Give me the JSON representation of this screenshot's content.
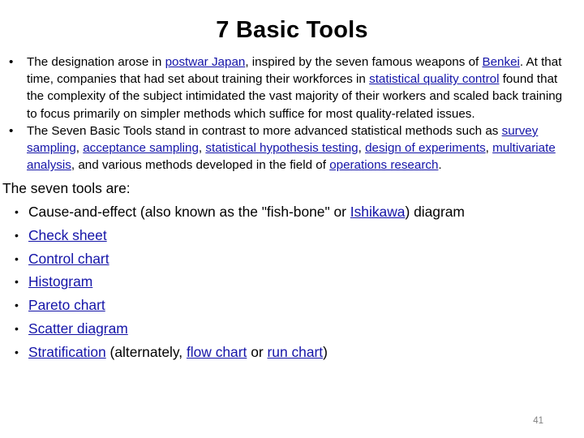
{
  "slide": {
    "title": "7 Basic Tools",
    "page_number": "41",
    "link_color": "#1414A8",
    "text_color": "#000000",
    "page_number_color": "#808080",
    "background_color": "#FFFFFF"
  },
  "bullet_glyph": "•",
  "paragraphs": [
    {
      "bullet": "•",
      "segments": [
        {
          "text": "The designation arose in ",
          "link": false
        },
        {
          "text": "postwar Japan",
          "link": true
        },
        {
          "text": ", inspired by the seven famous weapons of ",
          "link": false
        },
        {
          "text": "Benkei",
          "link": true
        },
        {
          "text": ".  At that time, companies that had set about training their workforces in ",
          "link": false
        },
        {
          "text": "statistical quality control",
          "link": true
        },
        {
          "text": " found that the complexity of the subject intimidated the vast majority of their workers and scaled back training to focus primarily on simpler methods which suffice for most quality-related issues.",
          "link": false
        }
      ]
    },
    {
      "bullet": "•",
      "segments": [
        {
          "text": "The Seven Basic Tools stand in contrast to more advanced statistical methods such as ",
          "link": false
        },
        {
          "text": "survey sampling",
          "link": true
        },
        {
          "text": ", ",
          "link": false
        },
        {
          "text": "acceptance sampling",
          "link": true
        },
        {
          "text": ", ",
          "link": false
        },
        {
          "text": "statistical hypothesis testing",
          "link": true
        },
        {
          "text": ", ",
          "link": false
        },
        {
          "text": "design of experiments",
          "link": true
        },
        {
          "text": ", ",
          "link": false
        },
        {
          "text": "multivariate analysis",
          "link": true
        },
        {
          "text": ", and various methods developed in the field of ",
          "link": false
        },
        {
          "text": "operations research",
          "link": true
        },
        {
          "text": ".",
          "link": false
        }
      ]
    }
  ],
  "lead_in": "The seven tools are:",
  "tools": [
    {
      "bullet": "•",
      "segments": [
        {
          "text": "Cause-and-effect (also known as the \"fish-bone\" or ",
          "link": false
        },
        {
          "text": "Ishikawa",
          "link": true
        },
        {
          "text": ") diagram",
          "link": false
        }
      ]
    },
    {
      "bullet": "•",
      "segments": [
        {
          "text": "Check sheet",
          "link": true
        }
      ]
    },
    {
      "bullet": "•",
      "segments": [
        {
          "text": "Control chart",
          "link": true
        }
      ]
    },
    {
      "bullet": "•",
      "segments": [
        {
          "text": "Histogram",
          "link": true
        }
      ]
    },
    {
      "bullet": "•",
      "segments": [
        {
          "text": "Pareto chart",
          "link": true
        }
      ]
    },
    {
      "bullet": "•",
      "segments": [
        {
          "text": "Scatter diagram",
          "link": true
        }
      ]
    },
    {
      "bullet": "•",
      "segments": [
        {
          "text": "Stratification",
          "link": true
        },
        {
          "text": " (alternately, ",
          "link": false
        },
        {
          "text": "flow chart",
          "link": true
        },
        {
          "text": " or ",
          "link": false
        },
        {
          "text": "run chart",
          "link": true
        },
        {
          "text": ")",
          "link": false
        }
      ]
    }
  ]
}
